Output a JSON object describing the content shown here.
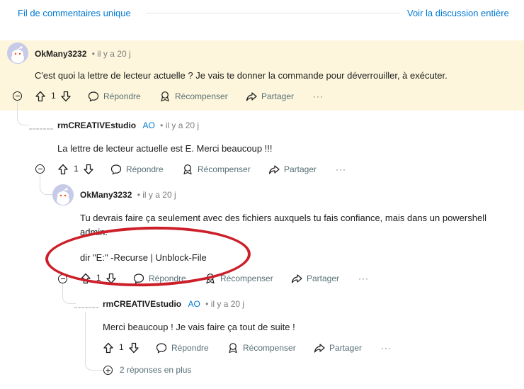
{
  "header": {
    "single_thread_link": "Fil de commentaires unique",
    "full_discussion_link": "Voir la discussion entière"
  },
  "colors": {
    "highlight_bg": "#fdf6dc",
    "link": "#0079d3",
    "annotation_red": "#cc1f2a"
  },
  "labels": {
    "reply": "Répondre",
    "award": "Récompenser",
    "share": "Partager",
    "op_badge": "AO",
    "more_dots": "···"
  },
  "comments": [
    {
      "user": "OkMany3232",
      "age": "• il y a 20 j",
      "text": "C'est quoi la lettre de lecteur actuelle ? Je vais te donner la commande pour déverrouiller, à exécuter.",
      "votes": "1"
    },
    {
      "user": "rmCREATIVEstudio",
      "op": true,
      "age": "• il y a 20 j",
      "text": "La lettre de lecteur actuelle est E. Merci beaucoup !!!",
      "votes": "1"
    },
    {
      "user": "OkMany3232",
      "age": "• il y a 20 j",
      "text_line1": "Tu devrais faire ça seulement avec des fichiers auxquels tu fais confiance, mais dans un powershell",
      "text_line2": "admin.",
      "code": "dir \"E:\" -Recurse | Unblock-File",
      "votes": "1"
    },
    {
      "user": "rmCREATIVEstudio",
      "op": true,
      "age": "• il y a 20 j",
      "text": "Merci beaucoup ! Je vais faire ça tout de suite !",
      "votes": "1"
    }
  ],
  "more_replies": "2 réponses en plus",
  "icons": [
    "collapse-icon",
    "upvote-icon",
    "downvote-icon",
    "reply-icon",
    "award-icon",
    "share-icon",
    "more-options-icon",
    "expand-icon",
    "avatar-icon"
  ]
}
